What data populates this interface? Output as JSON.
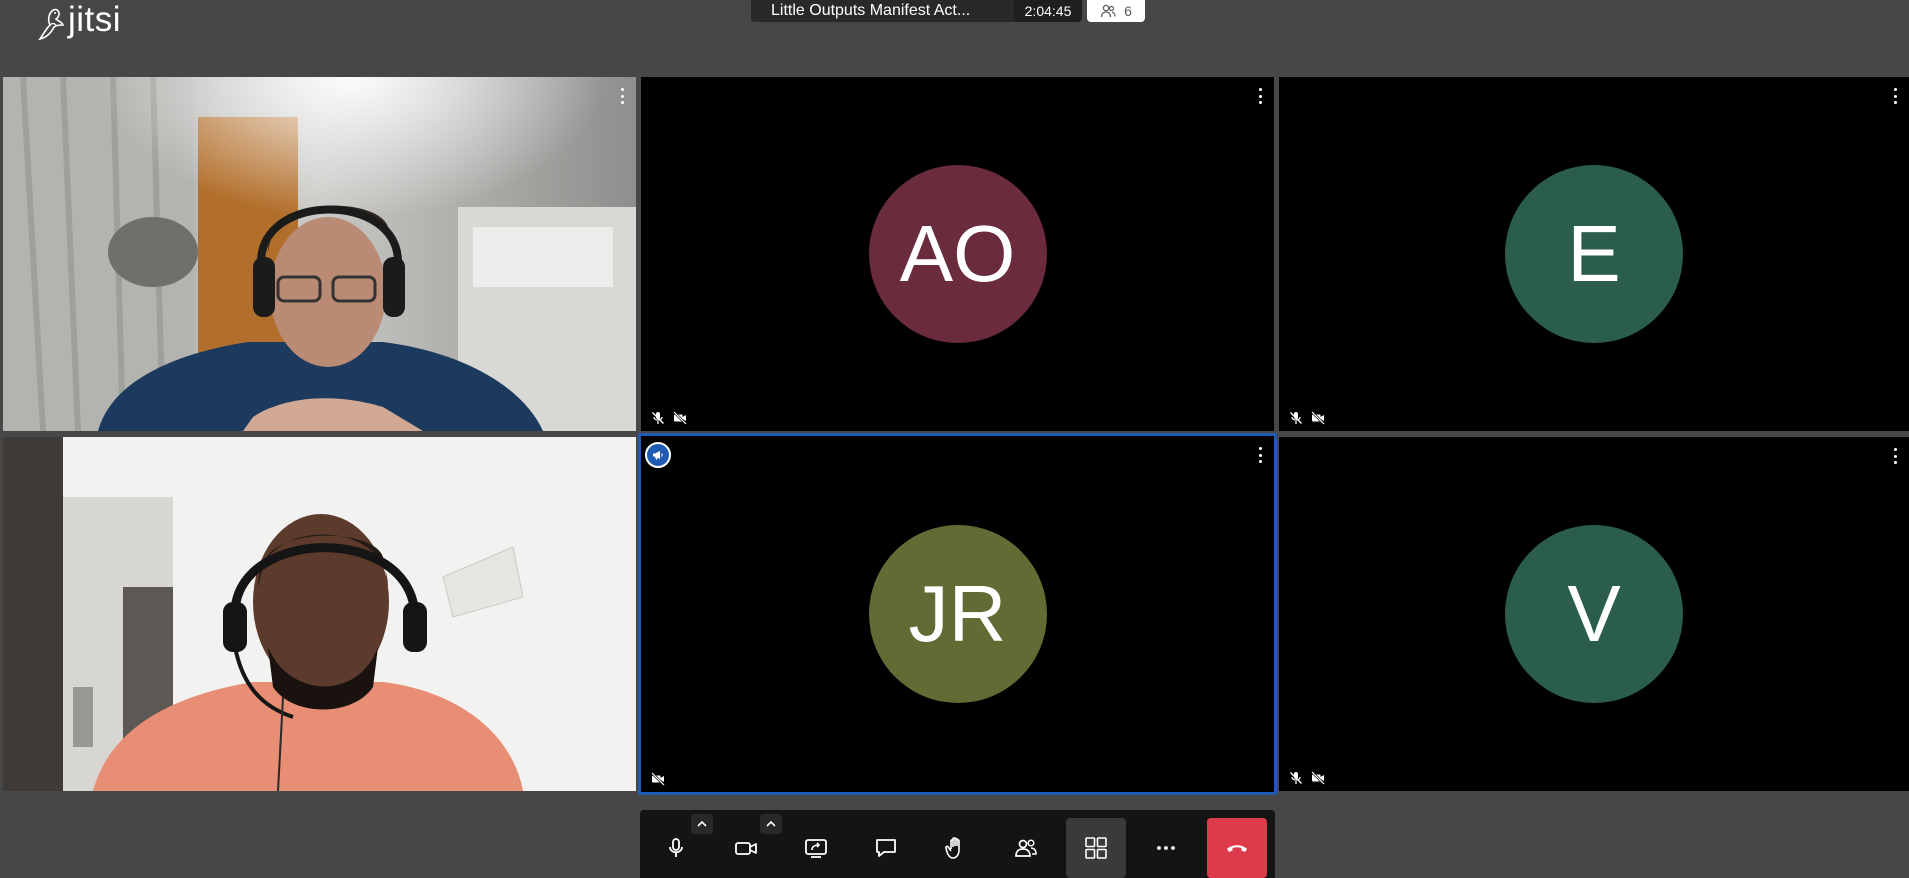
{
  "app": {
    "logo_text": "jitsi"
  },
  "header": {
    "subject": "Little Outputs Manifest Act...",
    "timer": "2:04:45",
    "participant_count": "6"
  },
  "tiles": [
    {
      "type": "video",
      "name": "participant-1-video"
    },
    {
      "type": "avatar",
      "initials": "AO",
      "color": "#6a2b3d",
      "audio_muted": true,
      "video_muted": true
    },
    {
      "type": "avatar",
      "initials": "E",
      "color": "#2a5e4b",
      "audio_muted": true,
      "video_muted": true
    },
    {
      "type": "video",
      "name": "participant-4-video"
    },
    {
      "type": "avatar",
      "initials": "JR",
      "color": "#636a34",
      "audio_muted": false,
      "video_muted": true,
      "dominant_speaker": true
    },
    {
      "type": "avatar",
      "initials": "V",
      "color": "#2a5e4b",
      "audio_muted": true,
      "video_muted": true
    }
  ],
  "toolbar": {
    "buttons": [
      {
        "name": "microphone",
        "icon": "microphone-icon"
      },
      {
        "name": "camera",
        "icon": "camera-icon"
      },
      {
        "name": "share-screen",
        "icon": "share-screen-icon"
      },
      {
        "name": "chat",
        "icon": "chat-icon"
      },
      {
        "name": "raise-hand",
        "icon": "hand-icon"
      },
      {
        "name": "participants",
        "icon": "participants-icon"
      },
      {
        "name": "tile-view",
        "icon": "grid-icon",
        "active": true
      },
      {
        "name": "more-actions",
        "icon": "more-icon"
      },
      {
        "name": "leave",
        "icon": "hangup-icon"
      }
    ]
  },
  "colors": {
    "background": "#474747",
    "hangup": "#dd3b4c",
    "dominant_speaker": "#1f5ab3"
  }
}
